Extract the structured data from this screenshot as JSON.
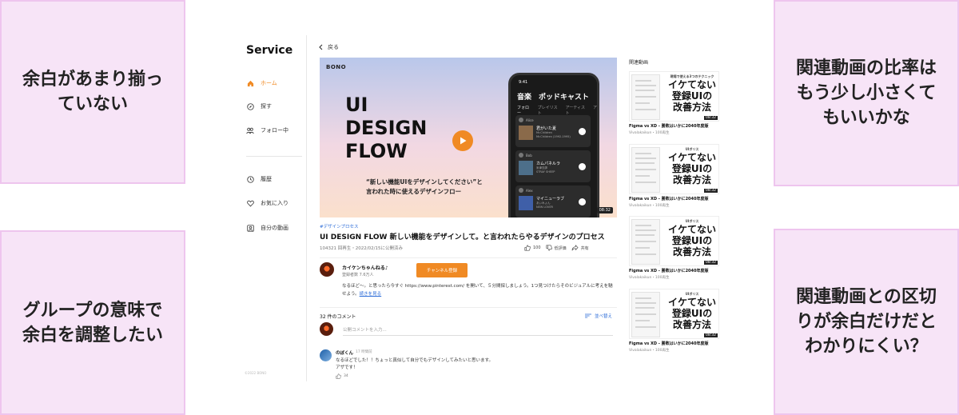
{
  "notes": {
    "top_left": "余白があまり揃っ\nていない",
    "bottom_left": "グループの意味で\n余白を調整したい",
    "top_right": "関連動画の比率は\nもう少し小さくて\nもいいかな",
    "bottom_right": "関連動画との区切\nりが余白だけだと\nわかりにくい？"
  },
  "sidebar": {
    "logo": "Service",
    "items": [
      {
        "label": "ホーム",
        "icon": "home-icon"
      },
      {
        "label": "探す",
        "icon": "compass-icon"
      },
      {
        "label": "フォロー中",
        "icon": "people-icon"
      },
      {
        "label": "履歴",
        "icon": "clock-icon"
      },
      {
        "label": "お気に入り",
        "icon": "heart-icon"
      },
      {
        "label": "自分の動画",
        "icon": "user-square-icon"
      }
    ],
    "copyright": "©2022 BONO"
  },
  "main": {
    "back_label": "戻る",
    "player": {
      "brand": "BONO",
      "headline": "UI\nDESIGN\nFLOW",
      "sub_copy": "“新しい機能UIをデザインしてください”と\n言われた時に使えるデザインフロー",
      "duration": "08:32",
      "phone": {
        "time": "9:41",
        "title": "音楽　ポッドキャスト",
        "tabs": [
          "フォロー",
          "プレイリスト",
          "アーティスト",
          "ア"
        ],
        "cards": [
          {
            "user": "Alice",
            "song": "君がいた夏",
            "artist": "Mr.Children\nMr.Children (1992-1995)"
          },
          {
            "user": "Bob",
            "song": "カムパネルラ",
            "artist": "米津玄師\nSTRAY SHEEP"
          },
          {
            "user": "Alex",
            "song": "マイニューラブ",
            "artist": "あいみょん\nNEW LOVER"
          }
        ]
      }
    },
    "tag": "#デザインプロセス",
    "title": "UI DESIGN FLOW 新しい機能をデザインして。と言われたらやるデザインのプロセス",
    "meta": "104321 回再生・2022/02/15に公開済み",
    "actions": {
      "likes": "100",
      "dislike": "低評価",
      "share": "共有"
    },
    "channel": {
      "name": "カイケンちゃんねる♪",
      "subscribers": "登録者数 7.6万人",
      "subscribe_label": "チャンネル登録"
    },
    "description": "なるほど〜。と思ったら今すぐ https://www.pinterest.com/ を開いて、５分間探しましょう。1つ見つけたらそのビジュアルに考えを馳せよう。",
    "description_more": "続きを見る",
    "comments": {
      "count_label": "32 件のコメント",
      "sort_label": "並べ替え",
      "input_placeholder": "公開コメントを入力...",
      "items": [
        {
          "name": "のぼくん",
          "time": "17 時間前",
          "text": "なるほどでした！！ちょっと真似して自分でもデザインしてみたいと思います。\nアザです！",
          "likes": "34"
        }
      ]
    }
  },
  "related": {
    "heading": "関連動画",
    "items": [
      {
        "thumb_top": "現場で使える3つのテクニック",
        "thumb_text": "イケてない\n登録UIの\n改善方法",
        "duration": "08:32",
        "title": "Figma vs XD - 勝敗はいかに2040年度版",
        "meta": "Vivalakaikun・100再生"
      },
      {
        "thumb_top": "UIボリス",
        "thumb_text": "イケてない\n登録UIの\n改善方法",
        "duration": "08:32",
        "title": "Figma vs XD - 勝敗はいかに2040年度版",
        "meta": "Vivalakaikun・100再生"
      },
      {
        "thumb_top": "UIボリス",
        "thumb_text": "イケてない\n登録UIの\n改善方法",
        "duration": "08:32",
        "title": "Figma vs XD - 勝敗はいかに2040年度版",
        "meta": "Vivalakaikun・100再生"
      },
      {
        "thumb_top": "UIボリス",
        "thumb_text": "イケてない\n登録UIの\n改善方法",
        "duration": "08:32",
        "title": "Figma vs XD - 勝敗はいかに2040年度版",
        "meta": "Vivalakaikun・100再生"
      }
    ]
  },
  "colors": {
    "accent": "#f08a24",
    "link": "#2f6ed8",
    "note_bg": "#f7e4f7",
    "note_border": "#eec5ee"
  }
}
